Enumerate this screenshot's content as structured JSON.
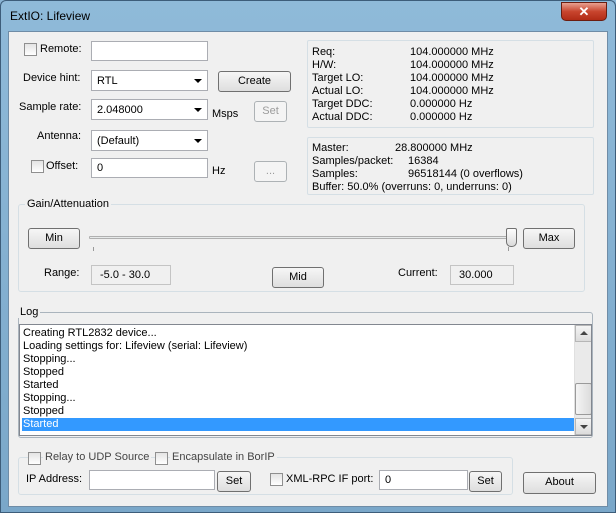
{
  "window": {
    "title": "ExtIO: Lifeview",
    "close_glyph": "✕"
  },
  "remote": {
    "label": "Remote:",
    "checked": false,
    "value": ""
  },
  "device_hint": {
    "label": "Device hint:",
    "value": "RTL",
    "create_label": "Create"
  },
  "sample_rate": {
    "label": "Sample rate:",
    "value": "2.048000",
    "unit": "Msps",
    "set_label": "Set"
  },
  "antenna": {
    "label": "Antenna:",
    "value": "(Default)"
  },
  "offset": {
    "label": "Offset:",
    "checked": false,
    "value": "0",
    "unit": "Hz",
    "more_label": "..."
  },
  "freq_info": [
    {
      "key": "Req:",
      "value": "104.000000 MHz"
    },
    {
      "key": "H/W:",
      "value": "104.000000 MHz"
    },
    {
      "key": "Target LO:",
      "value": "104.000000 MHz"
    },
    {
      "key": "Actual LO:",
      "value": "104.000000 MHz"
    },
    {
      "key": "Target DDC:",
      "value": "0.000000 Hz"
    },
    {
      "key": "Actual DDC:",
      "value": "0.000000 Hz"
    }
  ],
  "stream_info": {
    "master_key": "Master:",
    "master_value": "28.800000 MHz",
    "samples_packet_key": "Samples/packet:",
    "samples_packet_value": "16384",
    "samples_key": "Samples:",
    "samples_value": "96518144 (0 overflows)",
    "buffer_text": "Buffer: 50.0% (overruns: 0, underruns: 0)"
  },
  "gain": {
    "caption": "Gain/Attenuation",
    "min_label": "Min",
    "max_label": "Max",
    "mid_label": "Mid",
    "range_label": "Range:",
    "range_value": "-5.0 - 30.0",
    "current_label": "Current:",
    "current_value": "30.000",
    "slider_level": 1.0
  },
  "log": {
    "caption": "Log",
    "lines": [
      "Creating RTL2832 device...",
      "Loading settings for: Lifeview (serial: Lifeview)",
      "Stopping...",
      "Stopped",
      "Started",
      "Stopping...",
      "Stopped",
      "Started"
    ],
    "selected_index": 7
  },
  "udp": {
    "relay_label": "Relay to UDP Source",
    "encapsulate_label": "Encapsulate in BorIP",
    "ip_label": "IP Address:",
    "ip_value": "",
    "ip_set_label": "Set",
    "xmlrpc_label": "XML-RPC IF port:",
    "xmlrpc_value": "0",
    "xmlrpc_set_label": "Set"
  },
  "about_label": "About",
  "colors": {
    "selection": "#3399ff",
    "title_bg": "#8fbad9",
    "close": "#c8452e"
  }
}
